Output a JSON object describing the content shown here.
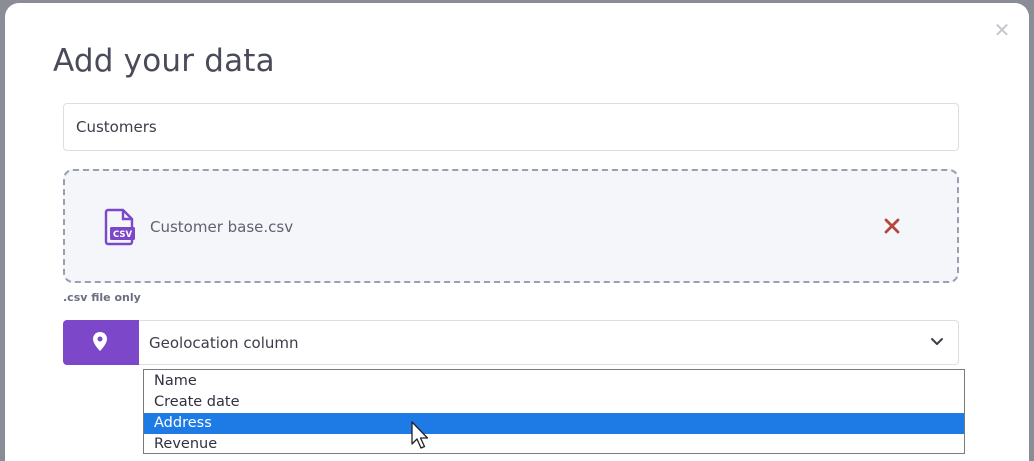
{
  "modal": {
    "title": "Add your data",
    "close_icon": "close-icon"
  },
  "dataset_name": {
    "value": "Customers"
  },
  "upload": {
    "file_name": "Customer base.csv",
    "file_icon": "csv-file-icon",
    "file_icon_text": "CSV",
    "remove_icon": "remove-file-icon",
    "hint": ".csv file only"
  },
  "geolocation": {
    "icon": "map-pin-icon",
    "select_label": "Geolocation column",
    "chevron_icon": "chevron-down-icon",
    "options": [
      {
        "label": "Name",
        "selected": false
      },
      {
        "label": "Create date",
        "selected": false
      },
      {
        "label": "Address",
        "selected": true
      },
      {
        "label": "Revenue",
        "selected": false
      }
    ]
  },
  "colors": {
    "accent": "#7c47c9",
    "remove": "#b5473a",
    "highlight": "#1e7be5"
  }
}
